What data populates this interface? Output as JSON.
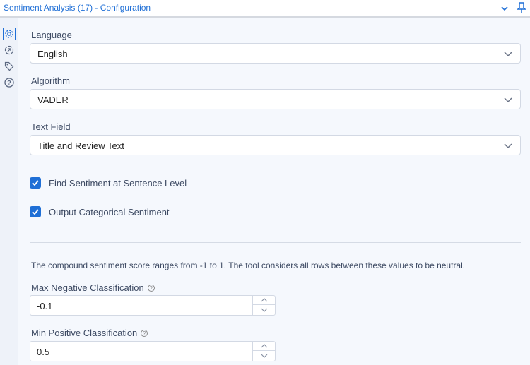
{
  "header": {
    "title": "Sentiment Analysis (17) - Configuration"
  },
  "language": {
    "label": "Language",
    "value": "English"
  },
  "algorithm": {
    "label": "Algorithm",
    "value": "VADER"
  },
  "text_field": {
    "label": "Text Field",
    "value": "Title and Review Text"
  },
  "checkboxes": [
    {
      "label": "Find Sentiment at Sentence Level",
      "checked": true
    },
    {
      "label": "Output Categorical Sentiment",
      "checked": true
    }
  ],
  "note": "The compound sentiment score ranges from -1 to 1. The tool considers all rows between these values to be neutral.",
  "max_negative": {
    "label": "Max Negative Classification",
    "value": "-0.1"
  },
  "min_positive": {
    "label": "Min Positive Classification",
    "value": "0.5"
  },
  "help_glyph": "?"
}
